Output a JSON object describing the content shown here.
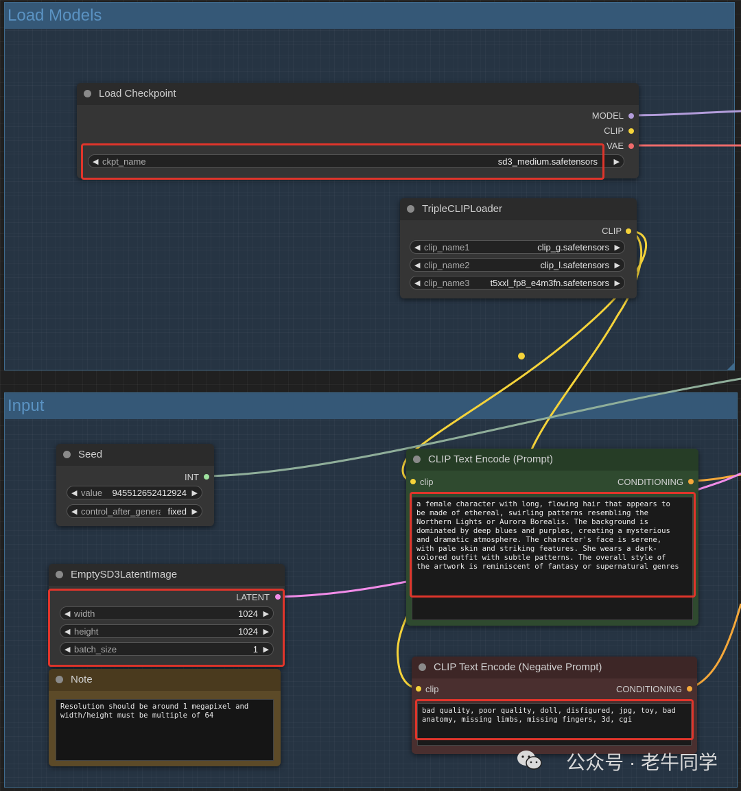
{
  "groups": {
    "load_models": {
      "title": "Load Models"
    },
    "input": {
      "title": "Input"
    }
  },
  "load_checkpoint": {
    "title": "Load Checkpoint",
    "outputs": [
      "MODEL",
      "CLIP",
      "VAE"
    ],
    "ckpt_name_label": "ckpt_name",
    "ckpt_name_value": "sd3_medium.safetensors"
  },
  "triple_clip_loader": {
    "title": "TripleCLIPLoader",
    "output": "CLIP",
    "widgets": [
      {
        "label": "clip_name1",
        "value": "clip_g.safetensors"
      },
      {
        "label": "clip_name2",
        "value": "clip_l.safetensors"
      },
      {
        "label": "clip_name3",
        "value": "t5xxl_fp8_e4m3fn.safetensors"
      }
    ]
  },
  "seed": {
    "title": "Seed",
    "output": "INT",
    "value_label": "value",
    "value": "945512652412924",
    "control_label": "control_after_generate",
    "control_value": "fixed"
  },
  "empty_latent": {
    "title": "EmptySD3LatentImage",
    "output": "LATENT",
    "widgets": [
      {
        "label": "width",
        "value": "1024"
      },
      {
        "label": "height",
        "value": "1024"
      },
      {
        "label": "batch_size",
        "value": "1"
      }
    ]
  },
  "note": {
    "title": "Note",
    "text": "Resolution should be around 1 megapixel and\nwidth/height must be multiple of 64"
  },
  "clip_positive": {
    "title": "CLIP Text Encode (Prompt)",
    "input": "clip",
    "output": "CONDITIONING",
    "text": "a female character with long, flowing hair that appears to\nbe made of ethereal, swirling patterns resembling the\nNorthern Lights or Aurora Borealis. The background is\ndominated by deep blues and purples, creating a mysterious\nand dramatic atmosphere. The character's face is serene,\nwith pale skin and striking features. She wears a dark-\ncolored outfit with subtle patterns. The overall style of\nthe artwork is reminiscent of fantasy or supernatural genres"
  },
  "clip_negative": {
    "title": "CLIP Text Encode (Negative Prompt)",
    "input": "clip",
    "output": "CONDITIONING",
    "text": "bad quality, poor quality, doll, disfigured, jpg, toy, bad\nanatomy, missing limbs, missing fingers, 3d, cgi"
  },
  "watermark": {
    "text": "公众号 · 老牛同学"
  },
  "colors": {
    "model": "#b39ddb",
    "clip": "#f5d33a",
    "vae": "#ef6b6b",
    "int": "#9fe29f",
    "latent": "#f18ce8",
    "conditioning": "#f5a83a",
    "highlight": "#e0352b",
    "positive_node": "#2f4a2f",
    "negative_node": "#4a2f2f",
    "note_node": "#5c4a28"
  }
}
